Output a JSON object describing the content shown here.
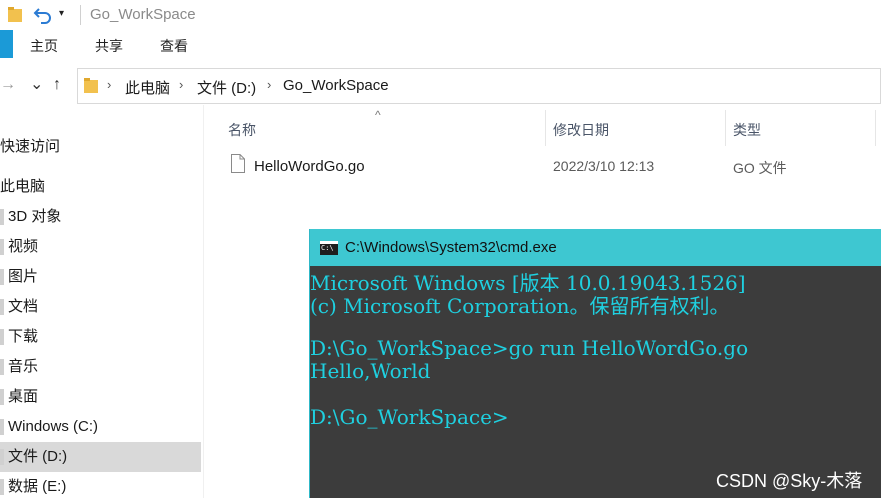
{
  "titlebar": {
    "title": "Go_WorkSpace",
    "dropdown": "▾"
  },
  "ribbon": {
    "tabs": [
      "主页",
      "共享",
      "查看"
    ]
  },
  "nav": {
    "back": "←",
    "forward": "→",
    "recent": "⌄",
    "up": "↑"
  },
  "address": {
    "crumbs": [
      "此电脑",
      "文件 (D:)",
      "Go_WorkSpace"
    ],
    "sep": "›"
  },
  "navpane": {
    "items": [
      "快速访问",
      "此电脑",
      "3D 对象",
      "视频",
      "图片",
      "文档",
      "下载",
      "音乐",
      "桌面",
      "Windows (C:)",
      "文件 (D:)",
      "数据 (E:)"
    ]
  },
  "columns": {
    "name": "名称",
    "modified": "修改日期",
    "type": "类型",
    "sort": "^"
  },
  "files": [
    {
      "name": "HelloWordGo.go",
      "modified": "2022/3/10 12:13",
      "type": "GO 文件"
    }
  ],
  "cmd": {
    "title": "C:\\Windows\\System32\\cmd.exe",
    "lines": [
      "Microsoft Windows [版本 10.0.19043.1526]",
      "(c) Microsoft Corporation。保留所有权利。",
      "",
      "D:\\Go_WorkSpace>go run HelloWordGo.go",
      "Hello,World",
      "",
      "D:\\Go_WorkSpace>"
    ]
  },
  "watermark": "CSDN @Sky-木落",
  "colors": {
    "cmd_bg": "#3c3c3c",
    "cmd_title": "#3ec7d1",
    "cmd_text": "#1fd0e0",
    "selected": "#d9d9d9",
    "folder": "#f2c14e"
  }
}
